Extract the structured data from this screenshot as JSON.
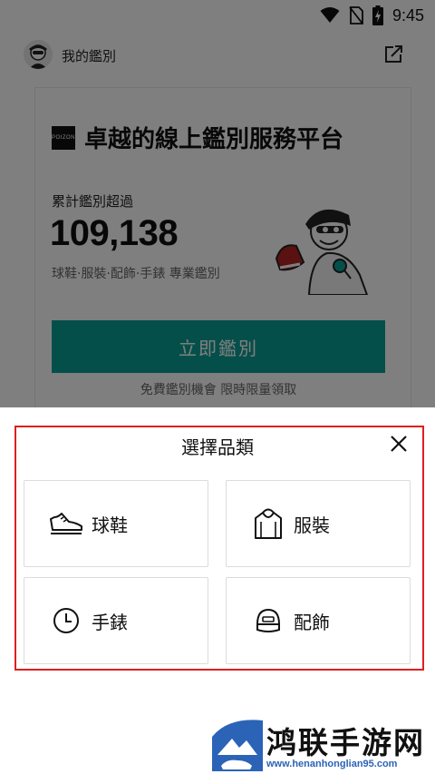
{
  "status_bar": {
    "time": "9:45",
    "icons": [
      "wifi-icon",
      "no-sim-icon",
      "battery-charging-icon"
    ]
  },
  "header": {
    "title": "我的鑑別",
    "share_icon": "share-external-icon"
  },
  "card": {
    "brand": "POIZON",
    "title": "卓越的線上鑑別服務平台",
    "stat_label": "累計鑑別超過",
    "stat_value": "109,138",
    "stat_desc": "球鞋·服裝·配飾·手錶 專業鑑別",
    "cta_label": "立即鑑別",
    "promo": "免費鑑別機會 限時限量領取"
  },
  "sheet": {
    "title": "選擇品類",
    "categories": [
      {
        "label": "球鞋",
        "icon": "sneaker-icon"
      },
      {
        "label": "服裝",
        "icon": "hoodie-icon"
      },
      {
        "label": "手錶",
        "icon": "clock-icon"
      },
      {
        "label": "配飾",
        "icon": "cap-icon"
      }
    ]
  },
  "watermark": {
    "title": "鸿联手游网",
    "subtitle": "www.henanhonglian95.com"
  },
  "colors": {
    "accent": "#0a9f94",
    "highlight": "#e01e1e",
    "watermark_blue": "#2b63b7"
  }
}
